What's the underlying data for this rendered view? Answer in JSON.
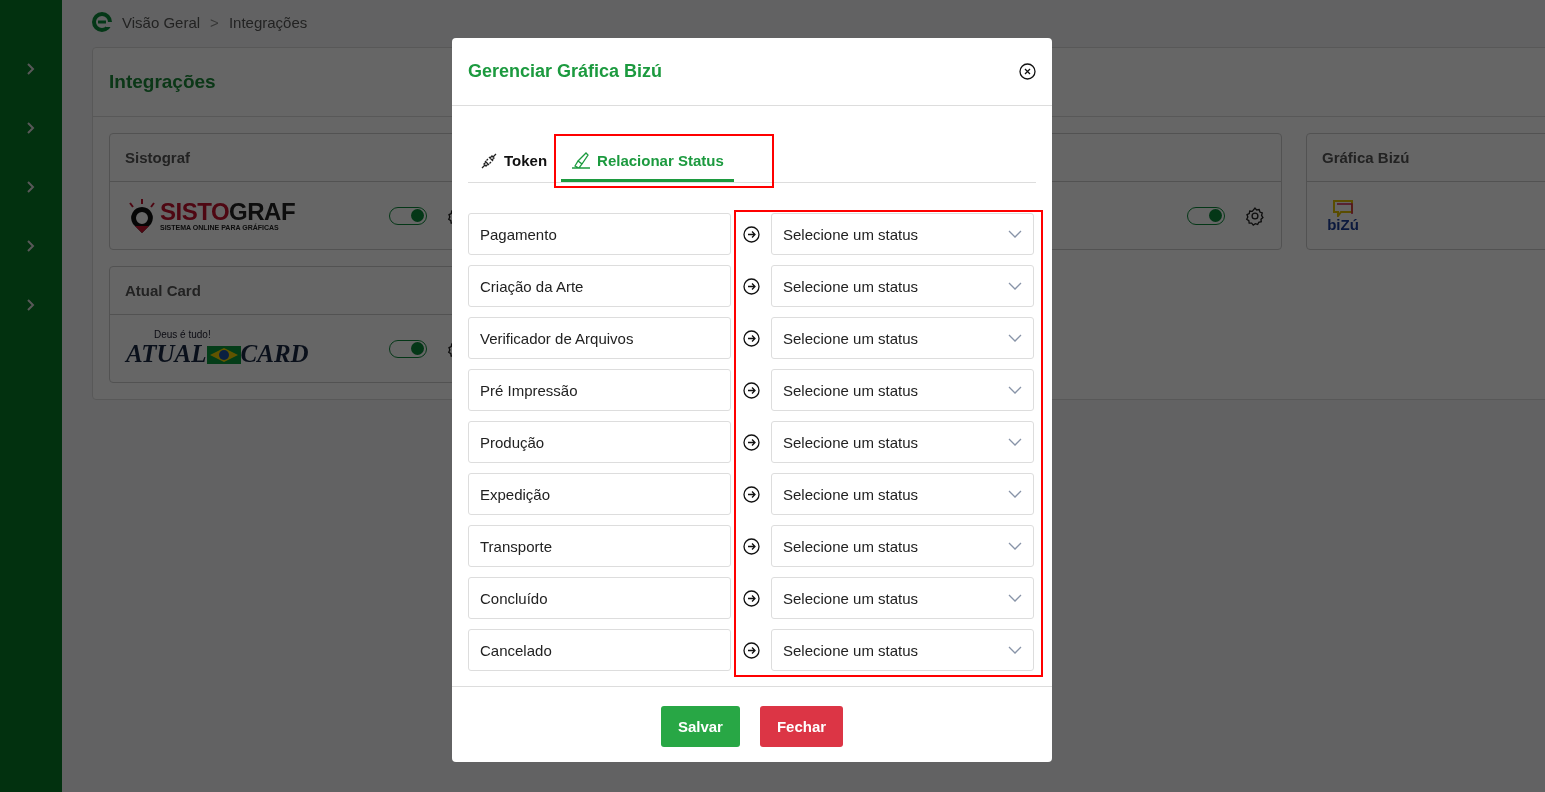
{
  "sidebar": {
    "items": [
      {
        "expanded": false
      },
      {
        "expanded": false
      },
      {
        "expanded": false
      },
      {
        "expanded": false
      },
      {
        "expanded": false
      }
    ]
  },
  "breadcrumb": {
    "items": [
      "Visão Geral",
      "Integrações"
    ],
    "separator": ">"
  },
  "panel": {
    "title": "Integrações",
    "rows": [
      {
        "cards": [
          {
            "title": "Sistograf",
            "logo": {
              "kind": "sistograf",
              "wordmark_part_1": "SISTO",
              "wordmark_part_2": "GRAF",
              "tagline": "SISTEMA ONLINE PARA GRÁFICAS"
            },
            "toggle_on": true
          },
          {
            "toggle_on": true
          },
          {
            "title": "Gráfica Bizú",
            "logo": {
              "kind": "bizu",
              "wordmark": "biZú"
            }
          }
        ]
      },
      {
        "cards": [
          {
            "title": "Atual Card",
            "logo": {
              "kind": "atualcard",
              "slogan": "Deus é tudo!",
              "wordmark_part_1": "ATUAL",
              "wordmark_part_2": "CARD"
            },
            "toggle_on": true
          }
        ]
      }
    ]
  },
  "modal": {
    "title": "Gerenciar Gráfica Bizú",
    "tabs": [
      {
        "label": "Token",
        "kind": "plug",
        "selected": false,
        "highlighted": false
      },
      {
        "label": "Relacionar Status",
        "kind": "brush",
        "selected": true,
        "highlighted": true
      }
    ],
    "status_column_highlighted": true,
    "mappings": [
      {
        "label": "Pagamento",
        "placeholder": "Selecione um status"
      },
      {
        "label": "Criação da Arte",
        "placeholder": "Selecione um status"
      },
      {
        "label": "Verificador de Arquivos",
        "placeholder": "Selecione um status"
      },
      {
        "label": "Pré Impressão",
        "placeholder": "Selecione um status"
      },
      {
        "label": "Produção",
        "placeholder": "Selecione um status"
      },
      {
        "label": "Expedição",
        "placeholder": "Selecione um status"
      },
      {
        "label": "Transporte",
        "placeholder": "Selecione um status"
      },
      {
        "label": "Concluído",
        "placeholder": "Selecione um status"
      },
      {
        "label": "Cancelado",
        "placeholder": "Selecione um status"
      }
    ],
    "buttons": [
      {
        "label": "Salvar",
        "kind": "primary"
      },
      {
        "label": "Fechar",
        "kind": "danger"
      }
    ]
  }
}
